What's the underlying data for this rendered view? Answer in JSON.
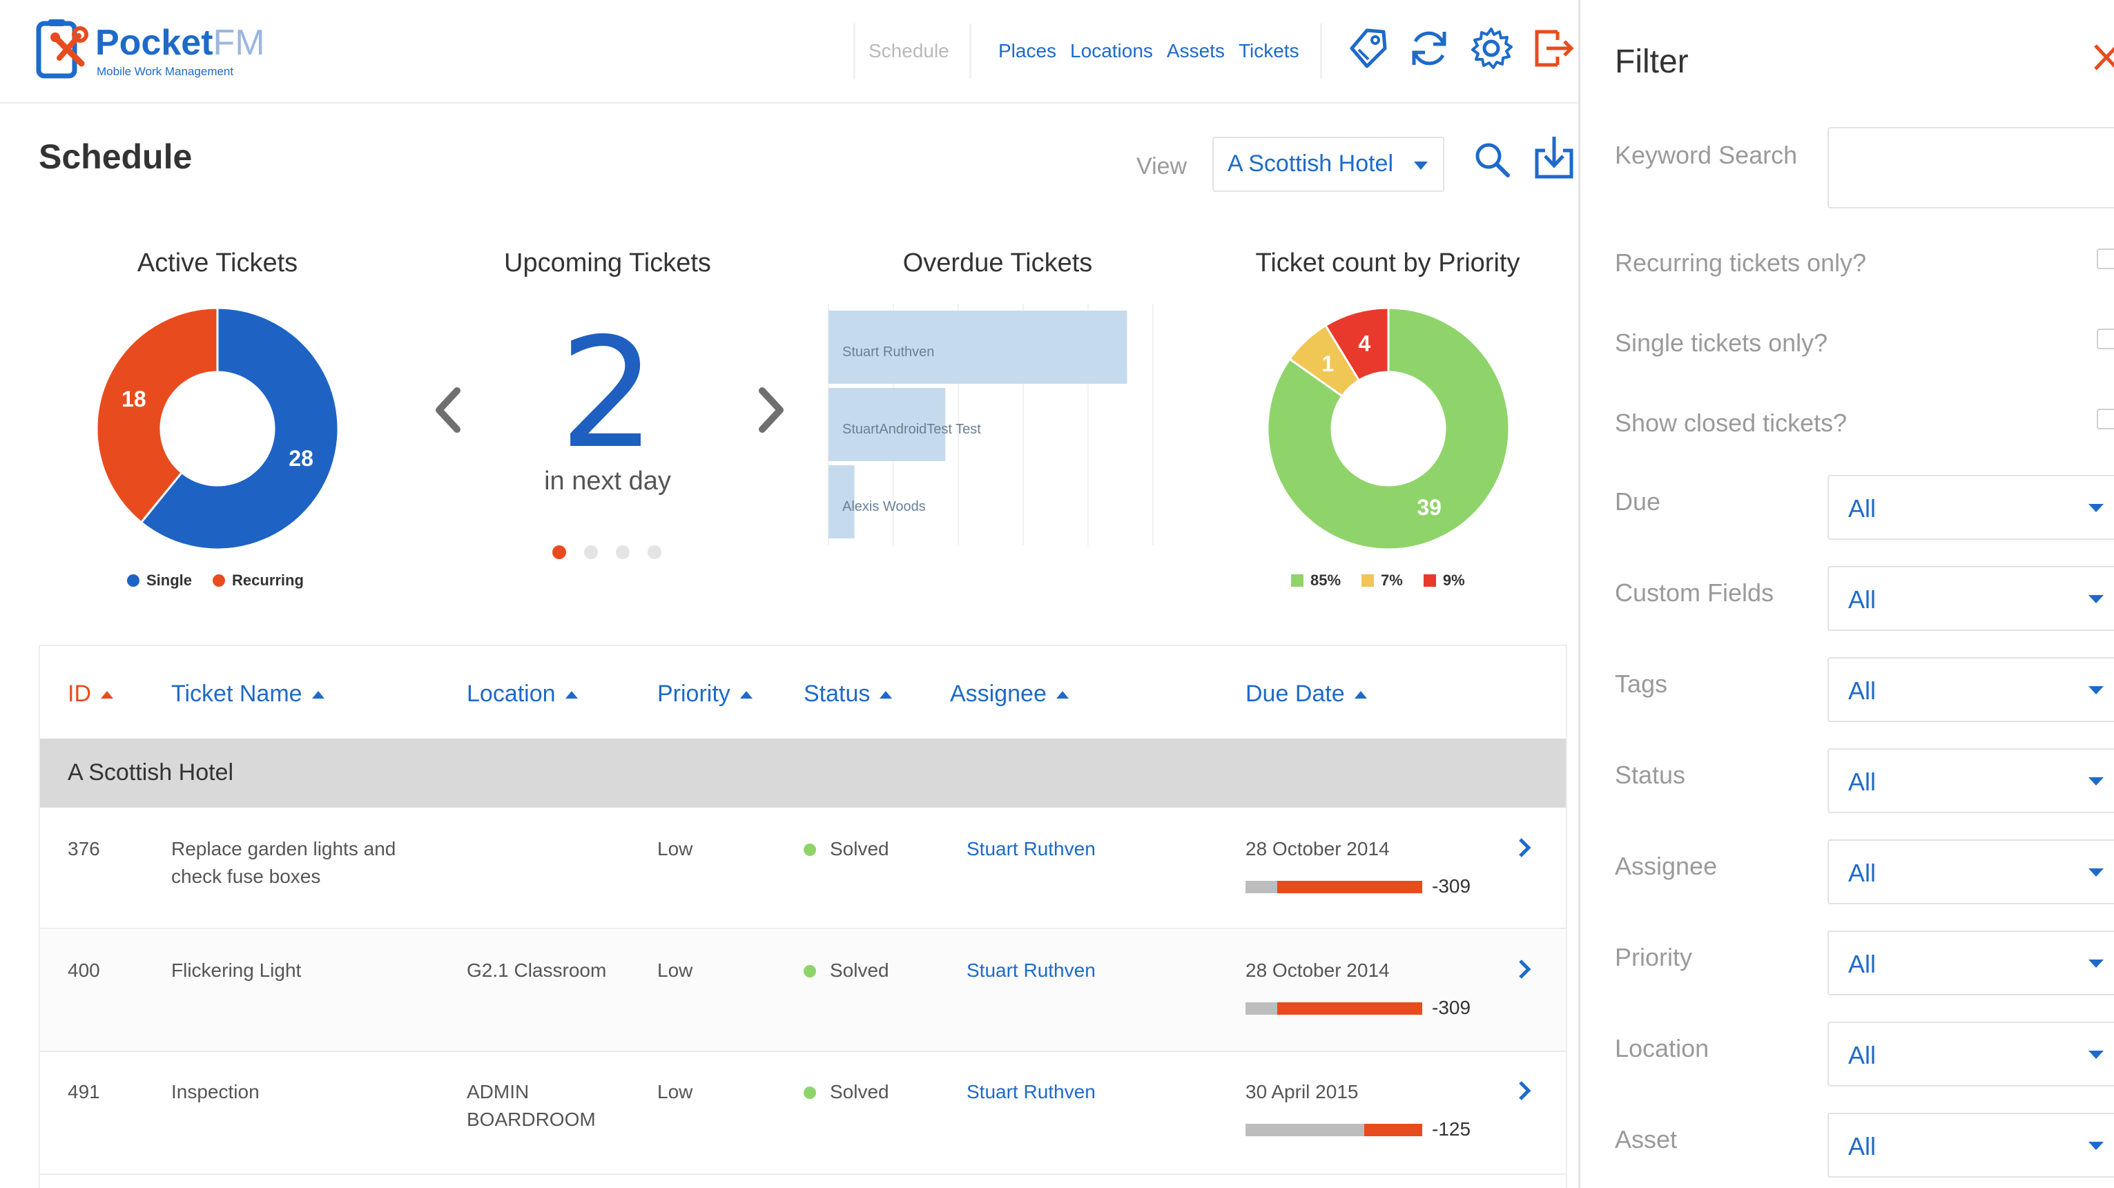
{
  "app": {
    "brand_main": "Pocket",
    "brand_suffix": "FM",
    "brand_tagline": "Mobile Work Management"
  },
  "nav": {
    "schedule": "Schedule",
    "links": [
      "Places",
      "Locations",
      "Assets",
      "Tickets"
    ],
    "icons": [
      "tag-icon",
      "refresh-icon",
      "gear-icon",
      "logout-icon"
    ]
  },
  "page": {
    "title": "Schedule",
    "view_label": "View",
    "view_value": "A Scottish Hotel"
  },
  "widgets": {
    "active": {
      "title": "Active Tickets",
      "legend": [
        "Single",
        "Recurring"
      ],
      "labels": [
        "28",
        "18"
      ]
    },
    "upcoming": {
      "title": "Upcoming Tickets",
      "value": "2",
      "subtitle": "in next day",
      "page_count": 4,
      "active_page": 1
    },
    "overdue": {
      "title": "Overdue Tickets"
    },
    "priority": {
      "title": "Ticket count by Priority",
      "legend": [
        "85%",
        "7%",
        "9%"
      ],
      "labels": [
        "39",
        "4",
        "1"
      ]
    }
  },
  "chart_data": [
    {
      "type": "pie",
      "title": "Active Tickets",
      "categories": [
        "Single",
        "Recurring"
      ],
      "values": [
        28,
        18
      ],
      "colors": [
        "#1e63c4",
        "#e84c1e"
      ]
    },
    {
      "type": "bar",
      "title": "Overdue Tickets",
      "orientation": "horizontal",
      "categories": [
        "Stuart Ruthven",
        "StuartAndroidTest Test",
        "Alexis Woods"
      ],
      "values": [
        23,
        9,
        2
      ],
      "xlim": [
        0,
        25
      ],
      "color": "#c6daee"
    },
    {
      "type": "pie",
      "title": "Ticket count by Priority",
      "categories": [
        "85%",
        "7%",
        "9%"
      ],
      "values": [
        39,
        3,
        4
      ],
      "slice_labels": [
        "39",
        "",
        "4"
      ],
      "colors": [
        "#8fd46a",
        "#f0c654",
        "#e8392c"
      ]
    }
  ],
  "table": {
    "headers": [
      "ID",
      "Ticket Name",
      "Location",
      "Priority",
      "Status",
      "Assignee",
      "Due Date"
    ],
    "group": "A Scottish Hotel",
    "rows": [
      {
        "id": "376",
        "name": "Replace garden lights and check fuse boxes",
        "location": "",
        "priority": "Low",
        "status": "Solved",
        "assignee": "Stuart Ruthven",
        "due": "28 October 2014",
        "diff": "-309",
        "overdue_fraction": 0.82
      },
      {
        "id": "400",
        "name": "Flickering Light",
        "location": "G2.1 Classroom",
        "priority": "Low",
        "status": "Solved",
        "assignee": "Stuart Ruthven",
        "due": "28 October 2014",
        "diff": "-309",
        "overdue_fraction": 0.82
      },
      {
        "id": "491",
        "name": "Inspection",
        "location": "ADMIN BOARDROOM",
        "priority": "Low",
        "status": "Solved",
        "assignee": "Stuart Ruthven",
        "due": "30 April 2015",
        "diff": "-125",
        "overdue_fraction": 0.33
      }
    ]
  },
  "filter": {
    "title": "Filter",
    "keyword_label": "Keyword Search",
    "keyword_value": "",
    "checks": [
      "Recurring tickets only?",
      "Single tickets only?",
      "Show closed tickets?"
    ],
    "selects": [
      {
        "label": "Due",
        "value": "All"
      },
      {
        "label": "Custom Fields",
        "value": "All"
      },
      {
        "label": "Tags",
        "value": "All"
      },
      {
        "label": "Status",
        "value": "All"
      },
      {
        "label": "Assignee",
        "value": "All"
      },
      {
        "label": "Priority",
        "value": "All"
      },
      {
        "label": "Location",
        "value": "All"
      },
      {
        "label": "Asset",
        "value": "All"
      }
    ]
  },
  "colors": {
    "primary": "#1e6ac9",
    "accent": "#e84c1e",
    "solved": "#8fd46a"
  }
}
